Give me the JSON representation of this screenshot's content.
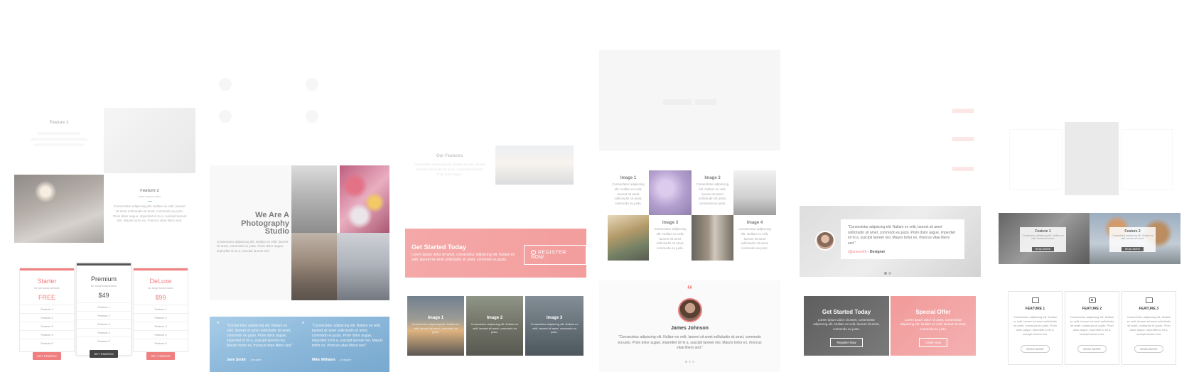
{
  "colors": {
    "accent": "#f08080",
    "cta_red": "#f4a4a4",
    "blue": "#8bbcdc",
    "dark": "#555555"
  },
  "features_block": {
    "feature1_title": "Feature 1",
    "feature2_title": "Feature 2",
    "feature2_subtitle": "lorem ipsum dolor",
    "feature2_text": "Consectetur adipiscing elit. Nullam ex velit, laoreet sit amet sollicitudin sit amet, commodo eu justo. Proin dolor augue, imperdiet id mi a, suscipit laoreet nisi. Mauris tortor ex, rhoncus vitae libero sed."
  },
  "pricing": {
    "plans": [
      {
        "name": "Starter",
        "sub": "for personal website",
        "price": "FREE",
        "features": [
          "Feature 1",
          "Feature 2",
          "Feature 3",
          "Feature 4",
          "Feature 5"
        ],
        "button": "GET STARTED"
      },
      {
        "name": "Premium",
        "sub": "for small businesses",
        "price": "$49",
        "features": [
          "Feature 1",
          "Feature 2",
          "Feature 3",
          "Feature 4",
          "Feature 5"
        ],
        "button": "GET STARTED"
      },
      {
        "name": "DeLuxe",
        "sub": "for large businesses",
        "price": "$99",
        "features": [
          "Feature 1",
          "Feature 2",
          "Feature 3",
          "Feature 4",
          "Feature 5"
        ],
        "button": "GET STARTED"
      }
    ]
  },
  "studio": {
    "title_line1": "We Are A",
    "title_line2": "Photography",
    "title_line3": "Studio",
    "text": "Consectetur adipiscing elit. Nullam ex velit, laoreet sit amet, commodo eu justo. Proin dolor augue, imperdiet id mi a, suscipit laoreet nisi."
  },
  "testimonials_blue": {
    "items": [
      {
        "text": "\"Consectetur adipiscing elit. Nullam ex velit, laoreet sit amet sollicitudin sit amet, commodo eu justo. Proin dolor augue, imperdiet id mi a, suscipit laoreet nisi. Mauris tortor ex, rhoncus vitae libero sed.\"",
        "name": "Jane Smith",
        "role": "- Designer"
      },
      {
        "text": "\"Consectetur adipiscing elit. Nullam ex velit, laoreet sit amet sollicitudin sit amet, commodo eu justo. Proin dolor augue, imperdiet id mi a, suscipit laoreet nisi. Mauris tortor ex, rhoncus vitae libero sed.\"",
        "name": "Mike Williams",
        "role": "- Designer"
      }
    ]
  },
  "our_features": {
    "title": "Our Features",
    "text": "Consectetur adipiscing elit. Nullam ex velit, laoreet sit amet sollicitudin sit amet, commodo eu justo. Proin dolor augue."
  },
  "cta_red": {
    "title": "Get Started Today",
    "text": "Lorem ipsum dolor sit amet, consectetur adipiscing elit. Nullam ex velit, laoreet sit amet sollicitudin sit amet, commodo eu justo.",
    "button": "REGISTER NOW"
  },
  "image_cards": {
    "items": [
      {
        "title": "Image 1",
        "text": "Consectetur adipiscing elit. Nullam ex velit, laoreet sit amet, commodo eu justo."
      },
      {
        "title": "Image 2",
        "text": "Consectetur adipiscing elit. Nullam ex velit, laoreet sit amet, commodo eu justo."
      },
      {
        "title": "Image 3",
        "text": "Consectetur adipiscing elit. Nullam ex velit, laoreet sit amet, commodo eu justo."
      }
    ]
  },
  "image_grid": {
    "image1": {
      "title": "Image 1",
      "text": "Consectetur adipiscing elit. Nullam ex velit, laoreet sit amet sollicitudin sit amet, commodo eu justo."
    },
    "image2": {
      "title": "Image 2",
      "text": "Consectetur adipiscing elit. Nullam ex velit, laoreet sit amet sollicitudin sit amet, commodo eu justo."
    },
    "image3": {
      "title": "Image 3",
      "text": "Consectetur adipiscing elit. Nullam ex velit, laoreet sit amet sollicitudin sit amet, commodo eu justo."
    },
    "image4": {
      "title": "Image 4",
      "text": "Consectetur adipiscing elit. Nullam ex velit, laoreet sit amet sollicitudin sit amet, commodo eu justo."
    }
  },
  "testimonial_single": {
    "quote_mark": "“",
    "name": "James Johnson",
    "text": "\"Consectetur adipiscing elit. Nullam ex velit, laoreet sit amet sollicitudin sit amet, commodo eu justo. Proin dolor augue, imperdiet id mi a, suscipit laoreet nisi. Mauris tortor ex, rhoncus vitae libero sed.\""
  },
  "testimonial_card": {
    "text": "\"Consectetur adipiscing elit. Nullam ex velit, laoreet sit amet sollicitudin sit amet, commodo eu justo. Proin dolor augue, imperdiet id mi a, suscipit laoreet nisi. Mauris tortor ex, rhoncus vitae libero sed.\"",
    "handle": "@janesmith",
    "role": " - Designer"
  },
  "dual_cta": {
    "left_title": "Get Started Today",
    "left_text": "Lorem ipsum dolor sit amet, consectetur adipiscing elit. Nullam ex velit, laoreet sit amet, commodo eu justo.",
    "left_button": "Register Now",
    "right_title": "Special Offer",
    "right_text": "Lorem ipsum dolor sit amet, consectetur adipiscing elit. Nullam ex velit, laoreet sit amet, commodo eu justo.",
    "right_button": "Order Now"
  },
  "feature_photos": {
    "f1_title": "Feature 1",
    "f1_text": "Consectetur adipiscing elit. Nullam ex velit, laoreet sit amet.",
    "f1_button": "READ MORE",
    "f2_title": "Feature 2",
    "f2_text": "Consectetur adipiscing elit. Nullam ex velit, laoreet sit amet.",
    "f2_button": "READ MORE"
  },
  "feature_cards": {
    "items": [
      {
        "icon": "briefcase-icon",
        "title": "FEATURE 1",
        "text": "Consectetur adipiscing elit. Nullam ex velit, laoreet sit amet sollicitudin sit amet, commodo eu justo. Proin dolor augue, imperdiet id mi a, suscipit laoreet nisi.",
        "button": "READ MORE"
      },
      {
        "icon": "camera-icon",
        "title": "FEATURE 2",
        "text": "Consectetur adipiscing elit. Nullam ex velit, laoreet sit amet sollicitudin sit amet, commodo eu justo. Proin dolor augue, imperdiet id mi a, suscipit laoreet nisi.",
        "button": "READ MORE"
      },
      {
        "icon": "wallet-icon",
        "title": "FEATURE 3",
        "text": "Consectetur adipiscing elit. Nullam ex velit, laoreet sit amet sollicitudin sit amet, commodo eu justo. Proin dolor augue, imperdiet id mi a, suscipit laoreet nisi.",
        "button": "READ MORE"
      }
    ]
  }
}
